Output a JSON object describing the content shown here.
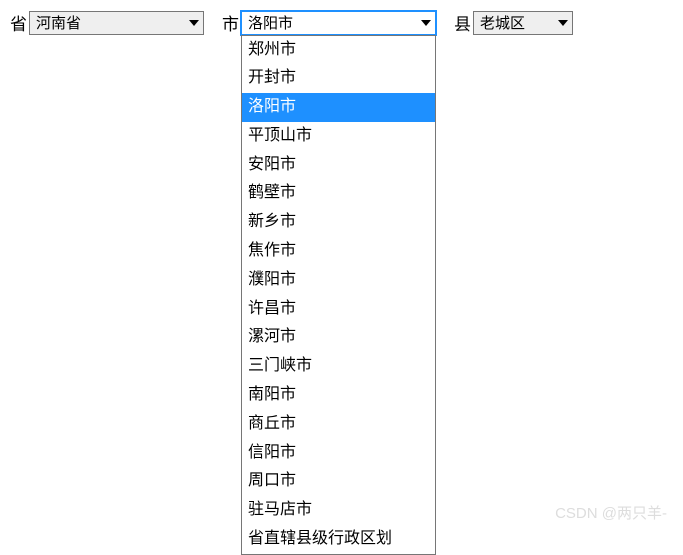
{
  "labels": {
    "province": "省",
    "city": "市",
    "county": "县"
  },
  "selected": {
    "province": "河南省",
    "city": "洛阳市",
    "county": "老城区"
  },
  "cityOptions": [
    "郑州市",
    "开封市",
    "洛阳市",
    "平顶山市",
    "安阳市",
    "鹤壁市",
    "新乡市",
    "焦作市",
    "濮阳市",
    "许昌市",
    "漯河市",
    "三门峡市",
    "南阳市",
    "商丘市",
    "信阳市",
    "周口市",
    "驻马店市",
    "省直辖县级行政区划"
  ],
  "watermark": "CSDN @两只羊-"
}
